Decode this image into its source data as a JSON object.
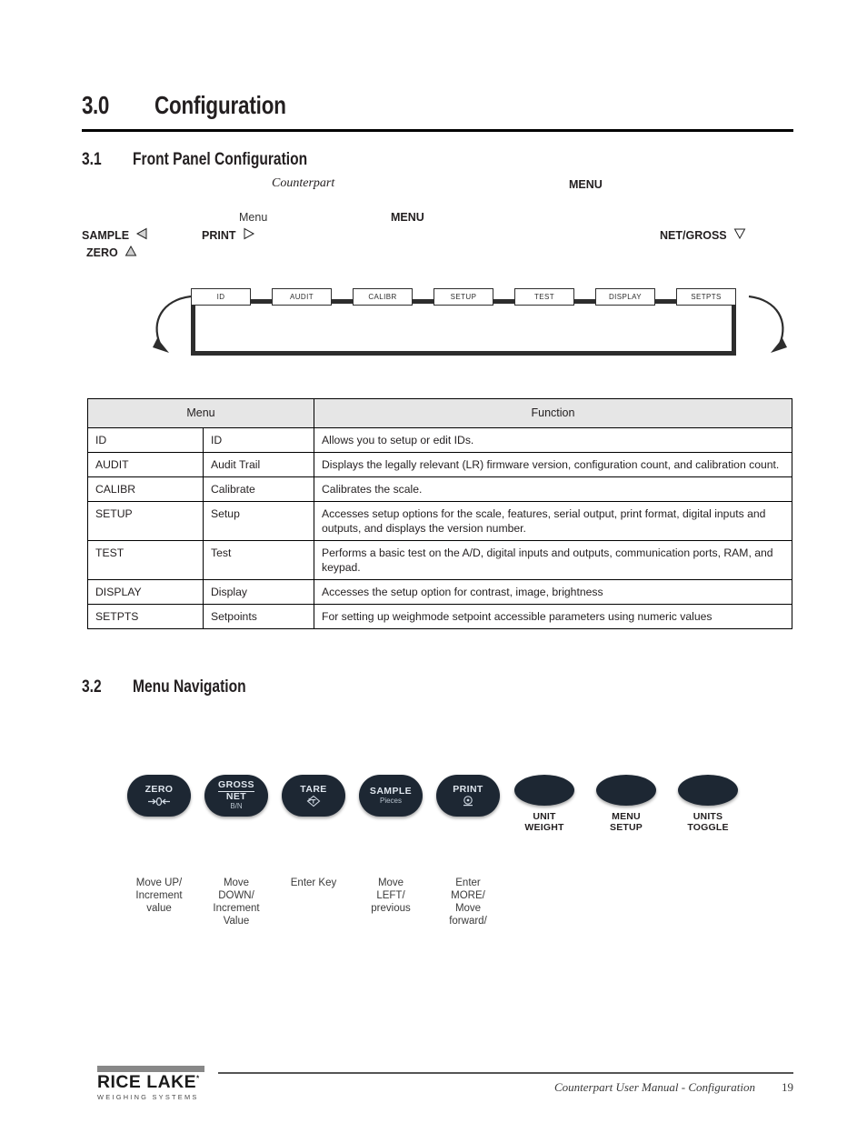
{
  "document": {
    "section": {
      "number": "3.0",
      "title": "Configuration"
    },
    "subsections": [
      {
        "number": "3.1",
        "title": "Front Panel Configuration"
      },
      {
        "number": "3.2",
        "title": "Menu Navigation"
      }
    ]
  },
  "intro": {
    "product_name": "Counterpart",
    "menu_bold_1": "MENU",
    "menu_plain": "Menu",
    "menu_bold_2": "MENU",
    "keys": [
      {
        "label": "SAMPLE",
        "arrow": "left-triangle-icon"
      },
      {
        "label": "PRINT",
        "arrow": "right-triangle-icon"
      },
      {
        "label": "NET/GROSS",
        "arrow": "down-triangle-icon"
      },
      {
        "label": "ZERO",
        "arrow": "up-triangle-icon"
      }
    ]
  },
  "flow_diagram": {
    "boxes": [
      "ID",
      "AUDIT",
      "CALIBR",
      "SETUP",
      "TEST",
      "DISPLAY",
      "SETPTS"
    ],
    "loop_left_arrow": "curved-arrow-left-icon",
    "loop_right_arrow": "curved-arrow-right-icon"
  },
  "menu_table": {
    "headers": [
      "Menu",
      "Function"
    ],
    "rows": [
      {
        "code": "ID",
        "name": "ID",
        "function": "Allows you to setup or edit IDs."
      },
      {
        "code": "AUDIT",
        "name": "Audit Trail",
        "function": "Displays the legally relevant (LR) firmware version, configuration count, and calibration count."
      },
      {
        "code": "CALIBR",
        "name": "Calibrate",
        "function": "Calibrates the scale."
      },
      {
        "code": "SETUP",
        "name": "Setup",
        "function": "Accesses setup options for the scale, features, serial output, print format, digital inputs and outputs, and displays the version number."
      },
      {
        "code": "TEST",
        "name": "Test",
        "function": "Performs a basic test on the A/D, digital inputs and outputs, communication ports, RAM, and keypad."
      },
      {
        "code": "DISPLAY",
        "name": "Display",
        "function": "Accesses the setup option for contrast, image, brightness"
      },
      {
        "code": "SETPTS",
        "name": "Setpoints",
        "function": "For setting up weighmode setpoint accessible parameters using numeric values"
      }
    ]
  },
  "keypad": {
    "primary_keys": [
      {
        "label": "ZERO",
        "sublabel": "",
        "glyph": "zero-arrows-icon",
        "caption": "Move UP/\nIncrement\nvalue"
      },
      {
        "label_top": "GROSS",
        "label_bottom": "NET",
        "sublabel": "B/N",
        "glyph": "",
        "caption": "Move\nDOWN/\nIncrement\nValue"
      },
      {
        "label": "TARE",
        "sublabel": "",
        "glyph": "tare-diamond-icon",
        "caption": "Enter Key"
      },
      {
        "label": "SAMPLE",
        "sublabel": "Pieces",
        "glyph": "",
        "caption": "Move\nLEFT/\nprevious"
      },
      {
        "label": "PRINT",
        "sublabel": "",
        "glyph": "print-icon",
        "caption": "Enter\nMORE/\nMove\nforward/"
      }
    ],
    "secondary_keys": [
      {
        "line1": "UNIT",
        "line2": "WEIGHT"
      },
      {
        "line1": "MENU",
        "line2": "SETUP"
      },
      {
        "line1": "UNITS",
        "line2": "TOGGLE"
      }
    ]
  },
  "footer": {
    "brand": "RICE LAKE",
    "brand_sub": "WEIGHING SYSTEMS",
    "manual_text": "Counterpart User Manual - Configuration",
    "page_number": "19"
  },
  "colors": {
    "key_fill": "#1d2733",
    "table_header_bg": "#e6e6e6",
    "rule": "#000000"
  }
}
